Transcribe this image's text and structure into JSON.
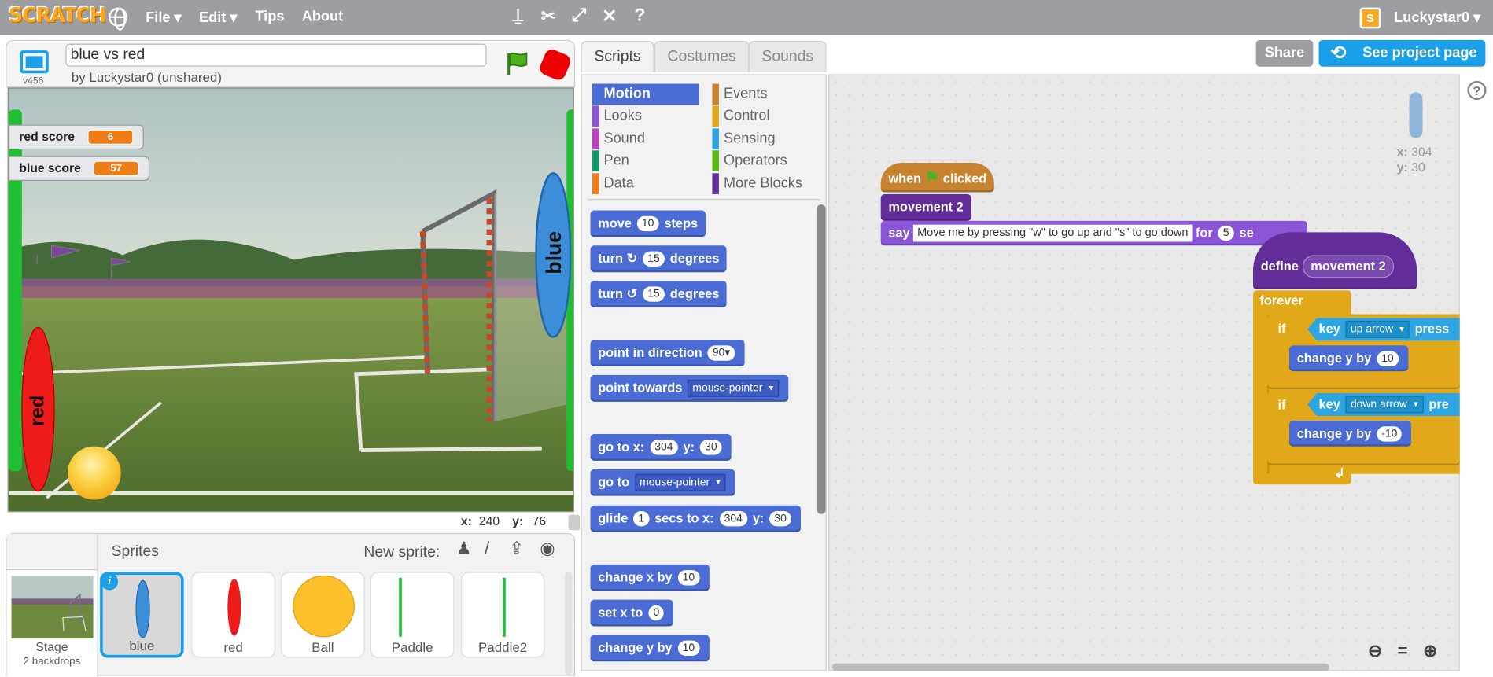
{
  "topbar": {
    "logo": "SCRATCH",
    "menus": [
      "File ▾",
      "Edit ▾",
      "Tips",
      "About"
    ],
    "tool_icons": [
      "duplicate-icon",
      "cut-icon",
      "grow-icon",
      "shrink-icon",
      "help-icon"
    ],
    "user": "Luckystar0 ▾"
  },
  "project": {
    "title": "blue vs red",
    "byline": "by Luckystar0 (unshared)",
    "version": "v456"
  },
  "stage": {
    "monitors": [
      {
        "label": "red score",
        "value": "6"
      },
      {
        "label": "blue score",
        "value": "57"
      }
    ],
    "paddle_labels": {
      "blue": "blue",
      "red": "red"
    },
    "mouse_x_label": "x:",
    "mouse_x": "240",
    "mouse_y_label": "y:",
    "mouse_y": "76"
  },
  "sprites_panel": {
    "title": "Sprites",
    "new_sprite": "New sprite:",
    "stage_label": "Stage",
    "stage_sub": "2 backdrops",
    "sprites": [
      {
        "name": "blue",
        "selected": true
      },
      {
        "name": "red",
        "selected": false
      },
      {
        "name": "Ball",
        "selected": false
      },
      {
        "name": "Paddle",
        "selected": false
      },
      {
        "name": "Paddle2",
        "selected": false
      }
    ]
  },
  "tabs": [
    "Scripts",
    "Costumes",
    "Sounds"
  ],
  "buttons": {
    "share": "Share",
    "see_project": "See project page"
  },
  "categories": {
    "left": [
      {
        "name": "Motion",
        "color": "#4a6cd4"
      },
      {
        "name": "Looks",
        "color": "#8a55d7"
      },
      {
        "name": "Sound",
        "color": "#bb42c3"
      },
      {
        "name": "Pen",
        "color": "#0e9a6c"
      },
      {
        "name": "Data",
        "color": "#ee7d16"
      }
    ],
    "right": [
      {
        "name": "Events",
        "color": "#c88330"
      },
      {
        "name": "Control",
        "color": "#e1a91a"
      },
      {
        "name": "Sensing",
        "color": "#2ca5e2"
      },
      {
        "name": "Operators",
        "color": "#5cb712"
      },
      {
        "name": "More Blocks",
        "color": "#632d99"
      }
    ]
  },
  "palette": {
    "move": {
      "a": "move",
      "v": "10",
      "b": "steps"
    },
    "turn_cw": {
      "a": "turn",
      "v": "15",
      "b": "degrees"
    },
    "turn_ccw": {
      "a": "turn",
      "v": "15",
      "b": "degrees"
    },
    "point_dir": {
      "a": "point in direction",
      "v": "90▾"
    },
    "point_towards": {
      "a": "point towards",
      "v": "mouse-pointer"
    },
    "goto_xy": {
      "a": "go to x:",
      "x": "304",
      "b": "y:",
      "y": "30"
    },
    "goto": {
      "a": "go to",
      "v": "mouse-pointer"
    },
    "glide": {
      "a": "glide",
      "s": "1",
      "b": "secs to x:",
      "x": "304",
      "c": "y:",
      "y": "30"
    },
    "change_x": {
      "a": "change x by",
      "v": "10"
    },
    "set_x": {
      "a": "set x to",
      "v": "0"
    },
    "change_y": {
      "a": "change y by",
      "v": "10"
    }
  },
  "scripts": {
    "hat": {
      "a": "when",
      "b": "clicked"
    },
    "call": "movement 2",
    "say": {
      "a": "say",
      "text": "Move me by pressing \"w\" to go up and \"s\" to go down",
      "b": "for",
      "v": "5",
      "c": "se"
    },
    "define": {
      "a": "define",
      "name": "movement 2"
    },
    "forever": "forever",
    "if1": {
      "a": "if",
      "key": "key",
      "opt": "up arrow",
      "tail": "press"
    },
    "change1": {
      "a": "change y by",
      "v": "10"
    },
    "if2": {
      "a": "if",
      "key": "key",
      "opt": "down arrow",
      "tail": "pre"
    },
    "change2": {
      "a": "change y by",
      "v": "-10"
    },
    "sprite_x_label": "x:",
    "sprite_x": "304",
    "sprite_y_label": "y:",
    "sprite_y": "30"
  },
  "zoom_icons": [
    "zoom-out-icon",
    "zoom-reset-icon",
    "zoom-in-icon"
  ]
}
